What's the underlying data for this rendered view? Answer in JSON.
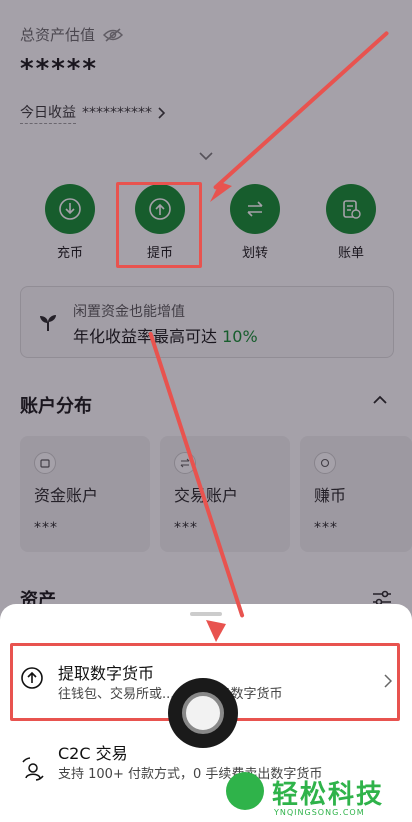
{
  "header": {
    "total_label": "总资产估值",
    "total_value": "*****",
    "today_label": "今日收益",
    "today_value": "**********"
  },
  "actions": [
    {
      "label": "充币",
      "icon": "deposit-icon"
    },
    {
      "label": "提币",
      "icon": "withdraw-icon"
    },
    {
      "label": "划转",
      "icon": "transfer-icon"
    },
    {
      "label": "账单",
      "icon": "bill-icon"
    }
  ],
  "promo": {
    "line1": "闲置资金也能增值",
    "line2": "年化收益率最高可达",
    "rate": "10%"
  },
  "distribution": {
    "title": "账户分布",
    "cards": [
      {
        "name": "资金账户",
        "value": "***"
      },
      {
        "name": "交易账户",
        "value": "***"
      },
      {
        "name": "赚币",
        "value": "***"
      }
    ]
  },
  "assets": {
    "title": "资产"
  },
  "sheet": {
    "options": [
      {
        "title": "提取数字货币",
        "desc": "往钱包、交易所或... 地址转出数字货币"
      },
      {
        "title": "C2C 交易",
        "desc": "支持 100+ 付款方式，0 手续费卖出数字货币"
      }
    ]
  },
  "watermark": {
    "big": "轻松科技",
    "small": "YNQINGSONG.COM"
  },
  "colors": {
    "accent": "#0b8a2a",
    "annotation": "#e8534f",
    "watermark": "#2fb34a"
  }
}
